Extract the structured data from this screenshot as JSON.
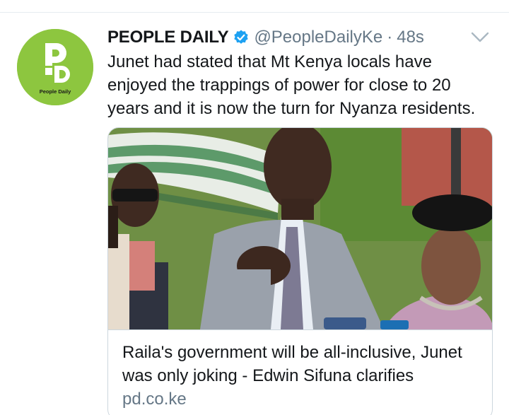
{
  "tweet": {
    "author": {
      "display_name": "PEOPLE DAILY",
      "handle": "@PeopleDailyKe",
      "avatar_text": "People Daily",
      "verified": true
    },
    "separator": "·",
    "timestamp": "48s",
    "text": "Junet had stated that Mt Kenya locals have\nenjoyed the trappings of power for close to 20\nyears and it is now the turn for Nyanza residents.",
    "card": {
      "title": "Raila's government will be all-inclusive, Junet was only joking - Edwin Sifuna clarifies",
      "domain": "pd.co.ke"
    }
  },
  "colors": {
    "brand_green": "#8dc63f",
    "verified_blue": "#1da1f2",
    "secondary_text": "#657786",
    "border": "#ccd6dd"
  },
  "icons": {
    "verified": "verified-badge-icon",
    "more": "chevron-down-icon"
  }
}
